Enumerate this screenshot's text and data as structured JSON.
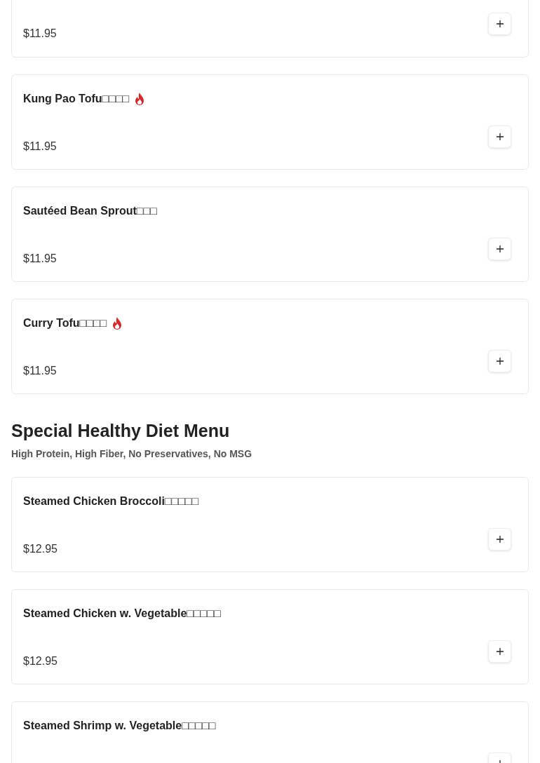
{
  "sections": [
    {
      "items": [
        {
          "price": "$11.95"
        },
        {
          "name": "Kung Pao Tofu□□□□",
          "price": "$11.95",
          "spicy": true
        },
        {
          "name": "Sautéed Bean Sprout□□□",
          "price": "$11.95",
          "spicy": false
        },
        {
          "name": "Curry Tofu□□□□",
          "price": "$11.95",
          "spicy": true
        }
      ]
    },
    {
      "title": "Special Healthy Diet Menu",
      "subtitle": "High Protein, High Fiber, No Preservatives, No MSG",
      "items": [
        {
          "name": "Steamed Chicken Broccoli□□□□□",
          "price": "$12.95",
          "spicy": false
        },
        {
          "name": "Steamed Chicken w. Vegetable□□□□□",
          "price": "$12.95",
          "spicy": false
        },
        {
          "name": "Steamed Shrimp w. Vegetable□□□□□",
          "spicy": false
        }
      ]
    }
  ]
}
